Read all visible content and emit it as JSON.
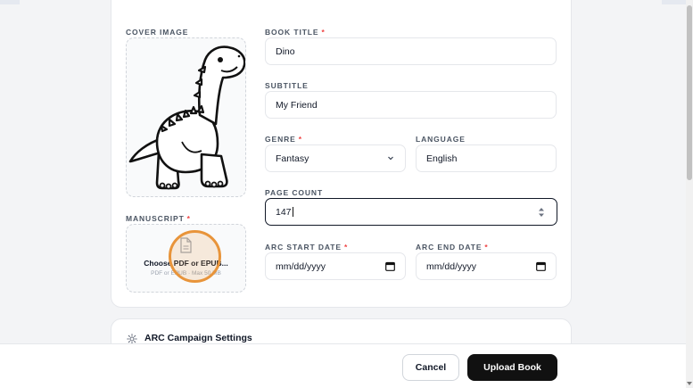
{
  "cover": {
    "label": "COVER IMAGE"
  },
  "manuscript": {
    "label": "MANUSCRIPT",
    "choose_text": "Choose PDF or EPUB...",
    "hint": "PDF or EPUB · Max 50 MB"
  },
  "title": {
    "label": "BOOK TITLE",
    "value": "Dino"
  },
  "subtitle": {
    "label": "SUBTITLE",
    "value": "My Friend"
  },
  "genre": {
    "label": "GENRE",
    "value": "Fantasy"
  },
  "language": {
    "label": "LANGUAGE",
    "value": "English"
  },
  "page_count": {
    "label": "PAGE COUNT",
    "value": "147"
  },
  "arc_start": {
    "label": "ARC START DATE",
    "placeholder": "mm/dd/yyyy"
  },
  "arc_end": {
    "label": "ARC END DATE",
    "placeholder": "mm/dd/yyyy"
  },
  "campaign": {
    "title": "ARC Campaign Settings"
  },
  "footer": {
    "cancel_label": "Cancel",
    "upload_label": "Upload Book"
  },
  "colors": {
    "primary": "#111111",
    "required": "#ef4444",
    "focus_ring": "#e8943a"
  }
}
